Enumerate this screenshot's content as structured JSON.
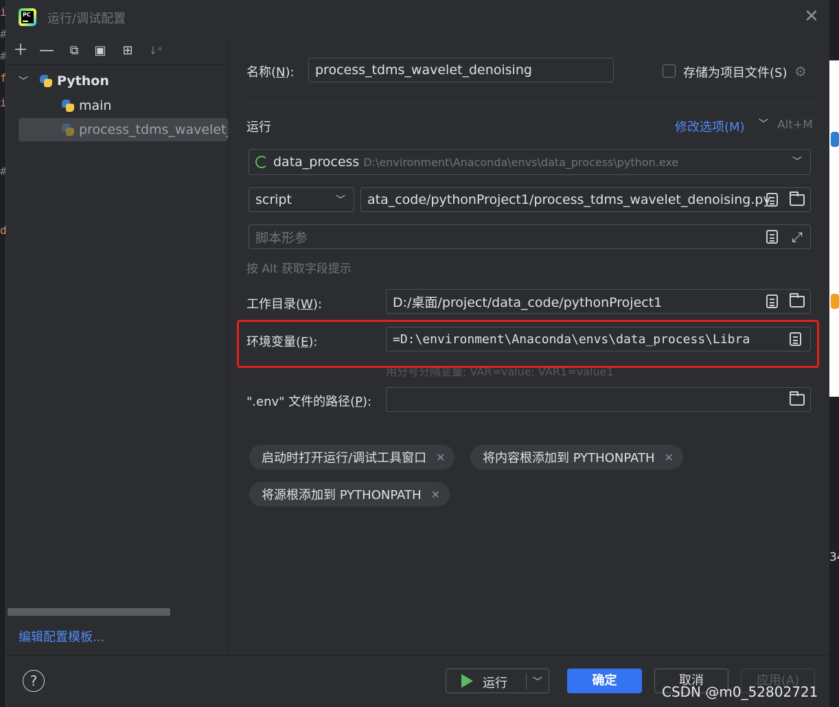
{
  "window": {
    "title": "运行/调试配置",
    "close_symbol": "✕"
  },
  "sidebar": {
    "group_label": "Python",
    "items": [
      {
        "label": "main"
      },
      {
        "label": "process_tdms_wavelet_"
      }
    ],
    "edit_templates_label": "编辑配置模板..."
  },
  "form": {
    "name_label_pre": "名称(",
    "name_label_key": "N",
    "name_label_post": "):",
    "name_value": "process_tdms_wavelet_denoising",
    "store_as_project_label": "存储为项目文件(S)",
    "run_section_label": "运行",
    "modify_options_label": "修改选项(M)",
    "modify_options_shortcut": "Alt+M",
    "interpreter_name": "data_process",
    "interpreter_path": "D:\\environment\\Anaconda\\envs\\data_process\\python.exe",
    "script_type": "script",
    "script_path": "ata_code/pythonProject1/process_tdms_wavelet_denoising.py",
    "script_params_placeholder": "脚本形参",
    "alt_hint": "按 Alt 获取字段提示",
    "workdir_label_pre": "工作目录(",
    "workdir_label_key": "W",
    "workdir_label_post": "):",
    "workdir_value": "D:/桌面/project/data_code/pythonProject1",
    "env_label_pre": "环境变量(",
    "env_label_key": "E",
    "env_label_post": "):",
    "env_value": "=D:\\environment\\Anaconda\\envs\\data_process\\Libra",
    "env_hint": "用分号分隔变量: VAR=value; VAR1=value1",
    "dotenv_label_pre": "\".env\" 文件的路径(",
    "dotenv_label_key": "P",
    "dotenv_label_post": "):",
    "dotenv_value": ""
  },
  "chips": [
    {
      "label": "启动时打开运行/调试工具窗口"
    },
    {
      "label": "将内容根添加到 PYTHONPATH"
    },
    {
      "label": "将源根添加到 PYTHONPATH"
    }
  ],
  "footer": {
    "help_label": "?",
    "run_label": "运行",
    "ok_label": "确定",
    "cancel_label": "取消",
    "apply_label": "应用(A)"
  },
  "watermark": "CSDN @m0_52802721",
  "background": {
    "right_number": "34"
  },
  "colors": {
    "accent": "#3574f0",
    "link": "#548af7",
    "highlight_box": "#e3201b"
  }
}
